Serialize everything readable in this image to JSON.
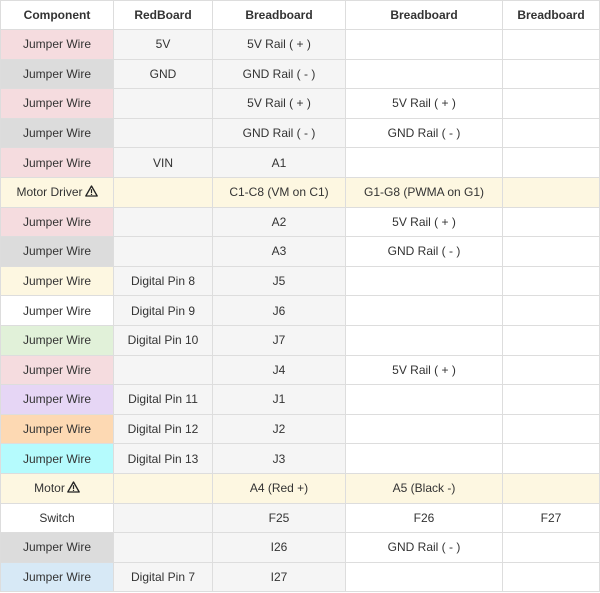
{
  "headers": [
    "Component",
    "RedBoard",
    "Breadboard",
    "Breadboard",
    "Breadboard"
  ],
  "colors": {
    "pink": "#f5dcdf",
    "gray": "#dcdcdc",
    "cream": "#fdf7e1",
    "white": "#ffffff",
    "green": "#e1f1d9",
    "purple": "#e6d6f5",
    "orange": "#fdd9b3",
    "cyan": "#b5fbfd",
    "blue": "#d7e9f6"
  },
  "rows": [
    {
      "color": "pink",
      "component": "Jumper Wire",
      "redboard": "5V",
      "bb1": "5V Rail ( + )",
      "bb2": "",
      "bb3": ""
    },
    {
      "color": "gray",
      "component": "Jumper Wire",
      "redboard": "GND",
      "bb1": "GND Rail ( - )",
      "bb2": "",
      "bb3": ""
    },
    {
      "color": "pink",
      "component": "Jumper Wire",
      "redboard": "",
      "bb1": "5V Rail ( + )",
      "bb2": "5V Rail ( + )",
      "bb3": ""
    },
    {
      "color": "gray",
      "component": "Jumper Wire",
      "redboard": "",
      "bb1": "GND Rail ( - )",
      "bb2": "GND Rail ( - )",
      "bb3": ""
    },
    {
      "color": "pink",
      "component": "Jumper Wire",
      "redboard": "VIN",
      "bb1": "A1",
      "bb2": "",
      "bb3": ""
    },
    {
      "color": "cream",
      "component": "Motor Driver",
      "warn": true,
      "redboard": "",
      "bb1": "C1-C8 (VM on C1)",
      "bb2": "G1-G8 (PWMA on G1)",
      "bb3": "",
      "full": true
    },
    {
      "color": "pink",
      "component": "Jumper Wire",
      "redboard": "",
      "bb1": "A2",
      "bb2": "5V Rail ( + )",
      "bb3": ""
    },
    {
      "color": "gray",
      "component": "Jumper Wire",
      "redboard": "",
      "bb1": "A3",
      "bb2": "GND Rail ( - )",
      "bb3": ""
    },
    {
      "color": "cream",
      "component": "Jumper Wire",
      "redboard": "Digital Pin 8",
      "bb1": "J5",
      "bb2": "",
      "bb3": ""
    },
    {
      "color": "white",
      "component": "Jumper Wire",
      "redboard": "Digital Pin 9",
      "bb1": "J6",
      "bb2": "",
      "bb3": ""
    },
    {
      "color": "green",
      "component": "Jumper Wire",
      "redboard": "Digital Pin 10",
      "bb1": "J7",
      "bb2": "",
      "bb3": ""
    },
    {
      "color": "pink",
      "component": "Jumper Wire",
      "redboard": "",
      "bb1": "J4",
      "bb2": "5V Rail ( + )",
      "bb3": ""
    },
    {
      "color": "purple",
      "component": "Jumper Wire",
      "redboard": "Digital Pin 11",
      "bb1": "J1",
      "bb2": "",
      "bb3": ""
    },
    {
      "color": "orange",
      "component": "Jumper Wire",
      "redboard": "Digital Pin 12",
      "bb1": "J2",
      "bb2": "",
      "bb3": ""
    },
    {
      "color": "cyan",
      "component": "Jumper Wire",
      "redboard": "Digital Pin 13",
      "bb1": "J3",
      "bb2": "",
      "bb3": ""
    },
    {
      "color": "cream",
      "component": "Motor",
      "warn": true,
      "redboard": "",
      "bb1": "A4 (Red +)",
      "bb2": "A5 (Black -)",
      "bb3": "",
      "full": true
    },
    {
      "color": "white",
      "component": "Switch",
      "redboard": "",
      "bb1": "F25",
      "bb2": "F26",
      "bb3": "F27"
    },
    {
      "color": "gray",
      "component": "Jumper Wire",
      "redboard": "",
      "bb1": "I26",
      "bb2": "GND Rail ( - )",
      "bb3": ""
    },
    {
      "color": "blue",
      "component": "Jumper Wire",
      "redboard": "Digital Pin 7",
      "bb1": "I27",
      "bb2": "",
      "bb3": ""
    }
  ]
}
